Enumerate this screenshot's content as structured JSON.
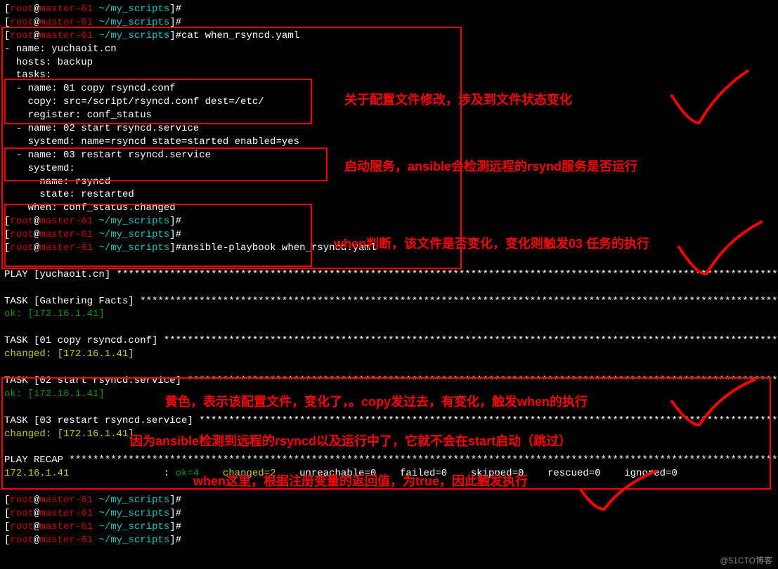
{
  "prompt": {
    "open": "[",
    "user": "root",
    "at": "@",
    "host": "master-61",
    "sep": " ",
    "path": "~/my_scripts",
    "close": "]",
    "hash": "#"
  },
  "cmds": {
    "cat": "cat when_rsyncd.yaml",
    "ansible": "ansible-playbook when_rsyncd.yaml"
  },
  "yaml": {
    "l1": "- name: yuchaoit.cn",
    "l2": "  hosts: backup",
    "l3": "  tasks:",
    "l4": "  - name: 01 copy rsyncd.conf",
    "l5": "    copy: src=/script/rsyncd.conf dest=/etc/",
    "l6": "    register: conf_status",
    "l7": "",
    "l8": "  - name: 02 start rsyncd.service",
    "l9": "    systemd: name=rsyncd state=started enabled=yes",
    "l10": "",
    "l11": "  - name: 03 restart rsyncd.service",
    "l12": "    systemd:",
    "l13": "      name: rsyncd",
    "l14": "      state: restarted",
    "l15": "    when: conf_status.changed"
  },
  "play": {
    "header": "PLAY [yuchaoit.cn] ",
    "task_facts": "TASK [Gathering Facts] ",
    "ok_host": "ok: [172.16.1.41]",
    "task1": "TASK [01 copy rsyncd.conf] ",
    "changed_host": "changed: [172.16.1.41]",
    "task2": "TASK [02 start rsyncd.service] ",
    "task3": "TASK [03 restart rsyncd.service] ",
    "recap": "PLAY RECAP ",
    "recap_host": "172.16.1.41",
    "recap_colon_pad": "                : ",
    "ok": "ok=4",
    "changed": "changed=2",
    "unreachable": "unreachable=0",
    "failed": "failed=0",
    "skipped": "skipped=0",
    "rescued": "rescued=0",
    "ignored": "ignored=0"
  },
  "stars": {
    "long": "*********************************************************************************************************************************",
    "play": "*******************************************************************************************************************",
    "facts": "**************************************************************************************************************",
    "t1": "***********************************************************************************************************",
    "t2": "*******************************************************************************************************",
    "t3": "*****************************************************************************************************",
    "recap": "*************************************************************************************************************************"
  },
  "annot": {
    "a1": "关于配置文件修改，涉及到文件状态变化",
    "a2": "启动服务，ansible会检测远程的rsynd服务是否运行",
    "a3": "when判断，该文件是否变化，变化则触发03 任务的执行",
    "a4": "黄色，表示该配置文件，变化了，。copy发过去，有变化，触发when的执行",
    "a5": "因为ansible检测到远程的rsyncd以及运行中了，它就不会在start启动（跳过）",
    "a6": "when这里，根据注册变量的返回值，为true，因此触发执行"
  },
  "watermark": "@51CTO博客"
}
